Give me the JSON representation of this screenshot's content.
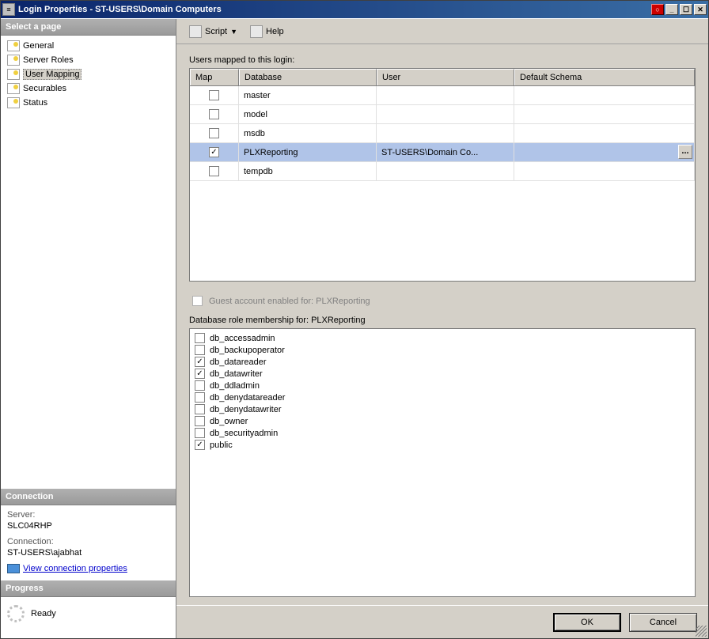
{
  "title": "Login Properties - ST-USERS\\Domain Computers",
  "sidebar": {
    "header": "Select a page",
    "items": [
      {
        "label": "General"
      },
      {
        "label": "Server Roles"
      },
      {
        "label": "User Mapping",
        "selected": true
      },
      {
        "label": "Securables"
      },
      {
        "label": "Status"
      }
    ],
    "connection_header": "Connection",
    "server_label": "Server:",
    "server_value": "SLC04RHP",
    "connection_label": "Connection:",
    "connection_value": "ST-USERS\\ajabhat",
    "view_conn_props": "View connection properties",
    "progress_header": "Progress",
    "progress_status": "Ready"
  },
  "toolbar": {
    "script_label": "Script",
    "help_label": "Help"
  },
  "main": {
    "users_mapped_label": "Users mapped to this login:",
    "columns": {
      "map": "Map",
      "database": "Database",
      "user": "User",
      "schema": "Default Schema"
    },
    "rows": [
      {
        "checked": false,
        "database": "master",
        "user": "",
        "schema": ""
      },
      {
        "checked": false,
        "database": "model",
        "user": "",
        "schema": ""
      },
      {
        "checked": false,
        "database": "msdb",
        "user": "",
        "schema": ""
      },
      {
        "checked": true,
        "database": "PLXReporting",
        "user": "ST-USERS\\Domain Co...",
        "schema": "",
        "selected": true
      },
      {
        "checked": false,
        "database": "tempdb",
        "user": "",
        "schema": ""
      }
    ],
    "guest_label": "Guest account enabled for: PLXReporting",
    "roles_label": "Database role membership for: PLXReporting",
    "roles": [
      {
        "name": "db_accessadmin",
        "checked": false
      },
      {
        "name": "db_backupoperator",
        "checked": false
      },
      {
        "name": "db_datareader",
        "checked": true
      },
      {
        "name": "db_datawriter",
        "checked": true
      },
      {
        "name": "db_ddladmin",
        "checked": false
      },
      {
        "name": "db_denydatareader",
        "checked": false
      },
      {
        "name": "db_denydatawriter",
        "checked": false
      },
      {
        "name": "db_owner",
        "checked": false
      },
      {
        "name": "db_securityadmin",
        "checked": false
      },
      {
        "name": "public",
        "checked": true
      }
    ],
    "ellipsis": "..."
  },
  "footer": {
    "ok": "OK",
    "cancel": "Cancel"
  }
}
